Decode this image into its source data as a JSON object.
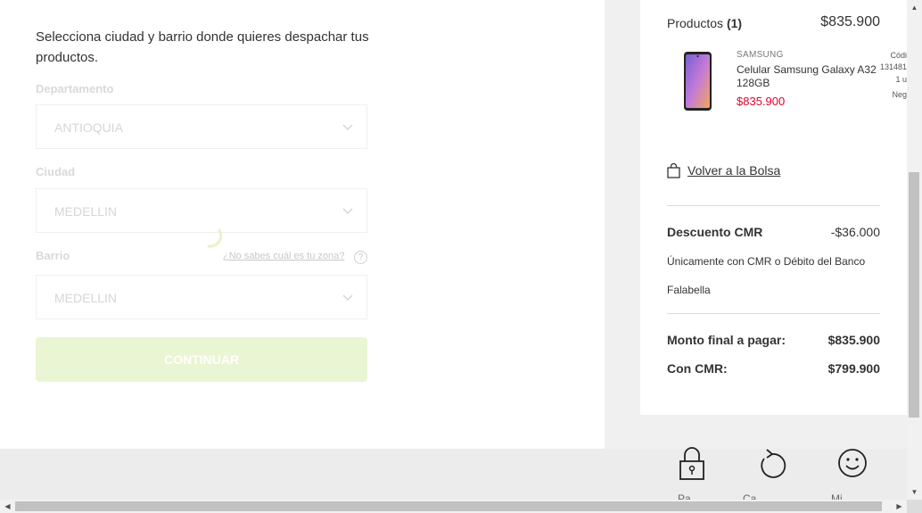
{
  "form": {
    "intro": "Selecciona ciudad y barrio donde quieres despachar tus productos.",
    "department": {
      "label": "Departamento",
      "value": "ANTIOQUIA"
    },
    "city": {
      "label": "Ciudad",
      "value": "MEDELLIN"
    },
    "neighborhood": {
      "label": "Barrio",
      "value": "MEDELLIN",
      "help_link": "¿No sabes cuál es tu zona?",
      "help_icon": "?"
    },
    "continue_label": "CONTINUAR"
  },
  "summary": {
    "products_label": "Productos",
    "products_count": "(1)",
    "products_total": "$835.900",
    "item": {
      "brand": "SAMSUNG",
      "name": "Celular Samsung Galaxy A32 128GB",
      "price": "$835.900",
      "code_label": "Códi",
      "code_value": "131481",
      "qty": "1 u",
      "color": "Neg"
    },
    "back_link": "Volver a la Bolsa",
    "discount_label": "Descuento CMR",
    "discount_value": "-$36.000",
    "discount_note": "Únicamente con CMR o Débito del Banco Falabella",
    "final_label": "Monto final a pagar:",
    "final_value": "$835.900",
    "cmr_label": "Con CMR:",
    "cmr_value": "$799.900"
  },
  "bottom_icons": [
    {
      "icon": "lock-icon",
      "caption": "Pa"
    },
    {
      "icon": "refresh-icon",
      "caption": "Ca"
    },
    {
      "icon": "smile-icon",
      "caption": "Mi"
    }
  ],
  "colors": {
    "price_red": "#e4002b",
    "button_disabled": "#eaf5d3"
  }
}
